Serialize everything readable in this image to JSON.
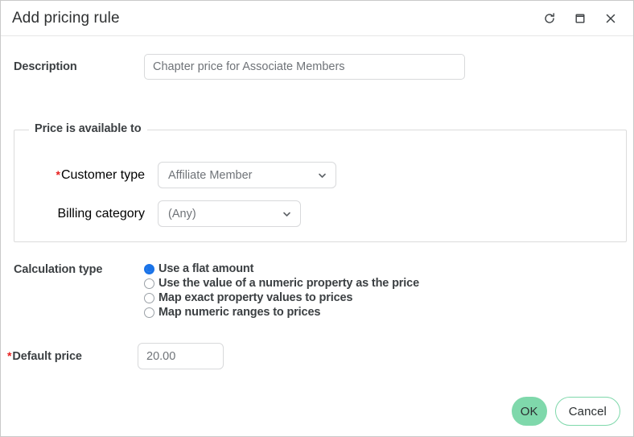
{
  "window": {
    "title": "Add pricing rule",
    "actions": [
      {
        "name": "refresh-icon",
        "label": "Refresh"
      },
      {
        "name": "maximize-icon",
        "label": "Maximize"
      },
      {
        "name": "close-icon",
        "label": "Close"
      }
    ]
  },
  "form": {
    "description": {
      "label": "Description",
      "value": "Chapter price for Associate Members",
      "placeholder": "Chapter price for Associate Members"
    },
    "availability": {
      "legend": "Price is available to",
      "customer_type": {
        "label": "Customer type",
        "required_marker": "*",
        "value": "Affiliate Member",
        "options": [
          "Affiliate Member"
        ]
      },
      "billing_category": {
        "label": "Billing category",
        "value": "(Any)",
        "options": [
          "(Any)"
        ]
      }
    },
    "calculation_type": {
      "label": "Calculation type",
      "options": [
        {
          "label": "Use a flat amount",
          "selected": true
        },
        {
          "label": "Use the value of a numeric property as the price",
          "selected": false
        },
        {
          "label": "Map exact property values to prices",
          "selected": false
        },
        {
          "label": "Map numeric ranges to prices",
          "selected": false
        }
      ]
    },
    "default_price": {
      "label": "Default price",
      "required_marker": "*",
      "value": "20.00",
      "placeholder": "20.00"
    }
  },
  "footer": {
    "ok_label": "OK",
    "cancel_label": "Cancel"
  },
  "colors": {
    "accent_green": "#7fd8ab",
    "radio_blue": "#1a73e8",
    "required_red": "#e8201f",
    "text": "#3c4043"
  }
}
